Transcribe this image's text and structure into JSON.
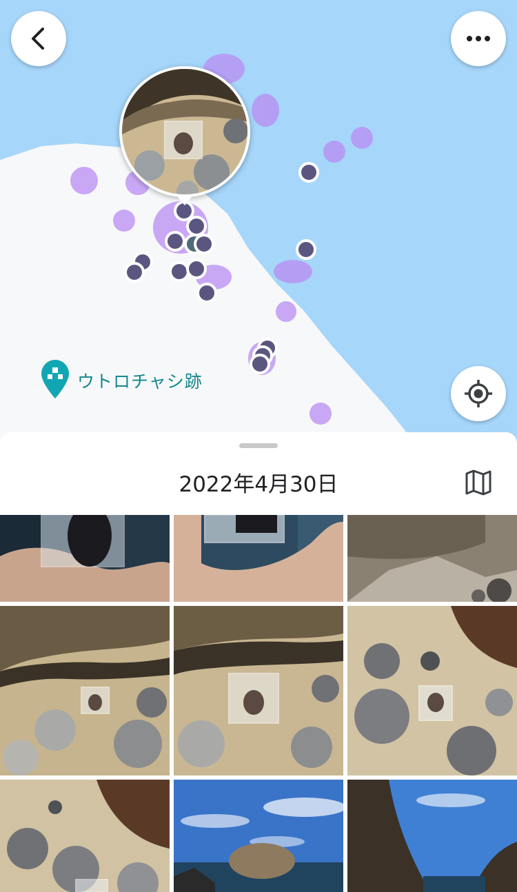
{
  "map": {
    "place_label": "ウトロチャシ跡",
    "icons": {
      "back": "chevron-left-icon",
      "more": "more-horizontal-icon",
      "locate": "my-location-icon",
      "pin": "place-pin-icon"
    },
    "colors": {
      "water": "#a6d6fa",
      "land": "#f7f8f9",
      "heat": "#b98cf3",
      "marker": "#5b5680",
      "place": "#12a6b4"
    }
  },
  "sheet": {
    "date": "2022年4月30日",
    "map_view_icon": "map-icon",
    "photo_count_visible": 9
  }
}
